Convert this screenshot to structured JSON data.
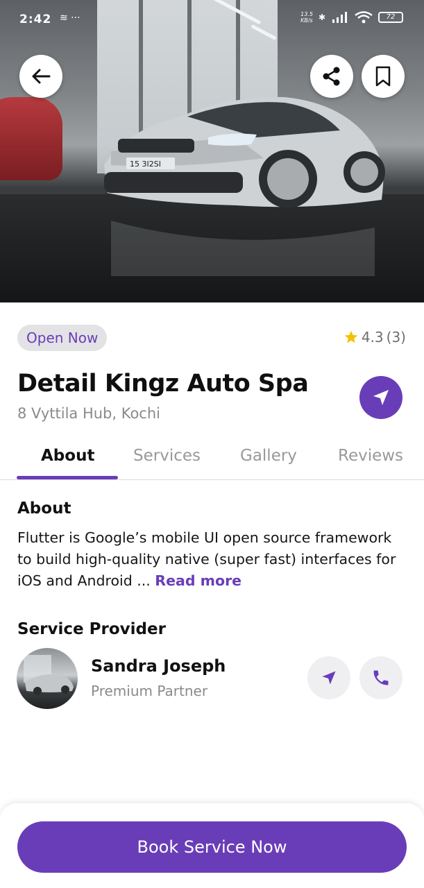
{
  "status_bar": {
    "time": "2:42",
    "net_speed_value": "13.5",
    "net_speed_unit": "KB/s",
    "battery": "72"
  },
  "hero": {
    "plate_text": "15 3I2SI"
  },
  "listing": {
    "status_badge": "Open Now",
    "rating": "4.3",
    "review_count": "(3)",
    "title": "Detail Kingz Auto Spa",
    "address": "8 Vyttila Hub, Kochi"
  },
  "tabs": [
    "About",
    "Services",
    "Gallery",
    "Reviews"
  ],
  "about": {
    "heading": "About",
    "text": "Flutter is Google’s mobile UI open source framework to build high-quality native (super fast) interfaces for iOS and Android ... ",
    "read_more": "Read more"
  },
  "provider": {
    "heading": "Service Provider",
    "name": "Sandra Joseph",
    "role": "Premium Partner"
  },
  "cta": {
    "label": "Book Service Now"
  },
  "colors": {
    "accent": "#6a3db8",
    "star": "#f2c200",
    "muted_text": "#8a8a8a"
  }
}
